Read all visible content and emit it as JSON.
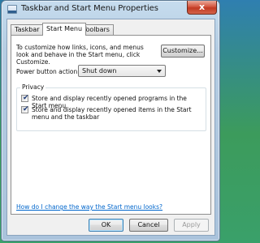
{
  "window": {
    "title": "Taskbar and Start Menu Properties",
    "close_glyph": "x"
  },
  "tabs": [
    {
      "label": "Taskbar",
      "active": false
    },
    {
      "label": "Start Menu",
      "active": true
    },
    {
      "label": "Toolbars",
      "active": false
    }
  ],
  "start_menu": {
    "description": "To customize how links, icons, and menus look and behave in the Start menu, click Customize.",
    "customize_label": "Customize...",
    "power_label": "Power button action:",
    "power_value": "Shut down"
  },
  "privacy": {
    "title": "Privacy",
    "items": [
      {
        "label": "Store and display recently opened programs in the Start menu",
        "checked": true
      },
      {
        "label": "Store and display recently opened items in the Start menu and the taskbar",
        "checked": true
      }
    ]
  },
  "help_link": "How do I change the way the Start menu looks?",
  "footer": {
    "ok_label": "OK",
    "cancel_label": "Cancel",
    "apply_label": "Apply"
  },
  "icons": {
    "window_icon": "app-window-icon",
    "close": "close-icon",
    "dropdown": "chevron-down-icon",
    "checkmark": "check-icon"
  },
  "check_glyph": "✔"
}
